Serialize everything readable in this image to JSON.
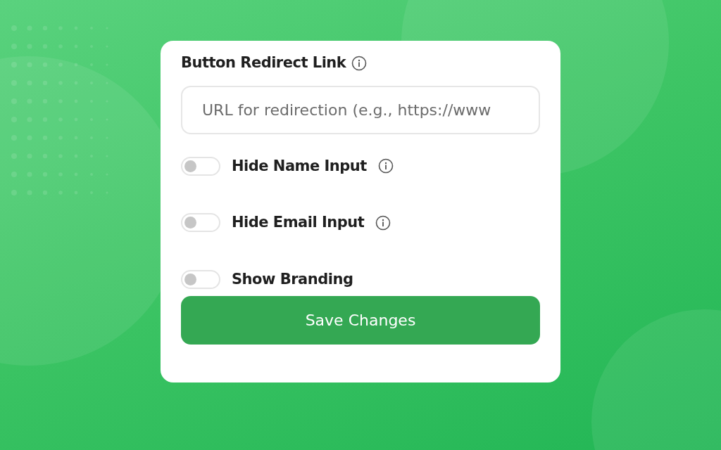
{
  "redirect": {
    "label": "Button Redirect Link",
    "info": true,
    "placeholder": "URL for redirection (e.g., https://www"
  },
  "toggles": [
    {
      "label": "Hide Name Input",
      "on": false,
      "info": true
    },
    {
      "label": "Hide Email Input",
      "on": false,
      "info": true
    },
    {
      "label": "Show Branding",
      "on": false,
      "info": false
    }
  ],
  "save_button": "Save Changes"
}
